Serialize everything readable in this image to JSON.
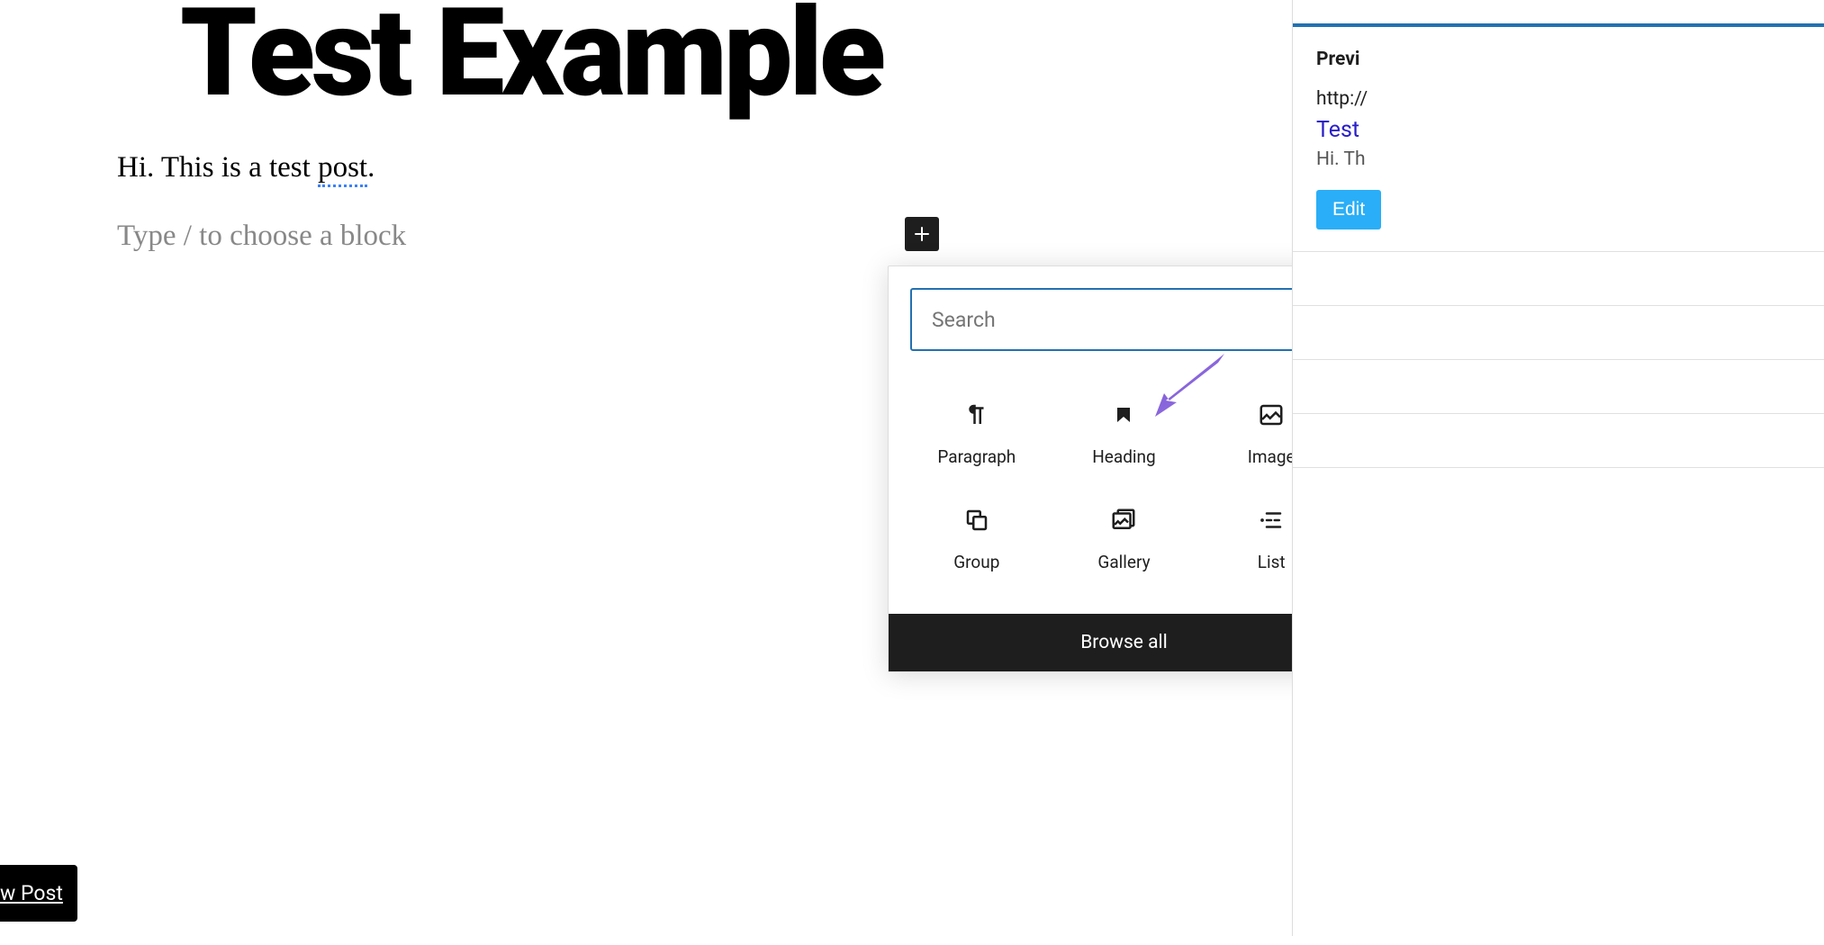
{
  "editor": {
    "title": "Test Example",
    "content": "Hi. This is a test ",
    "content_underlined": "post",
    "content_after": ".",
    "placeholder": "Type / to choose a block"
  },
  "inserter": {
    "search_placeholder": "Search",
    "blocks": [
      {
        "label": "Paragraph",
        "icon": "paragraph"
      },
      {
        "label": "Heading",
        "icon": "heading"
      },
      {
        "label": "Image",
        "icon": "image"
      },
      {
        "label": "Group",
        "icon": "group"
      },
      {
        "label": "Gallery",
        "icon": "gallery"
      },
      {
        "label": "List",
        "icon": "list"
      }
    ],
    "browse_all": "Browse all"
  },
  "sidebar": {
    "preview_label": "Previ",
    "url": "http://",
    "title": "Test ",
    "snippet": "Hi. Th",
    "edit_label": "Edit"
  },
  "footer": {
    "new_post": "w Post"
  },
  "annotation": {
    "arrow_color": "#7e57d4"
  }
}
